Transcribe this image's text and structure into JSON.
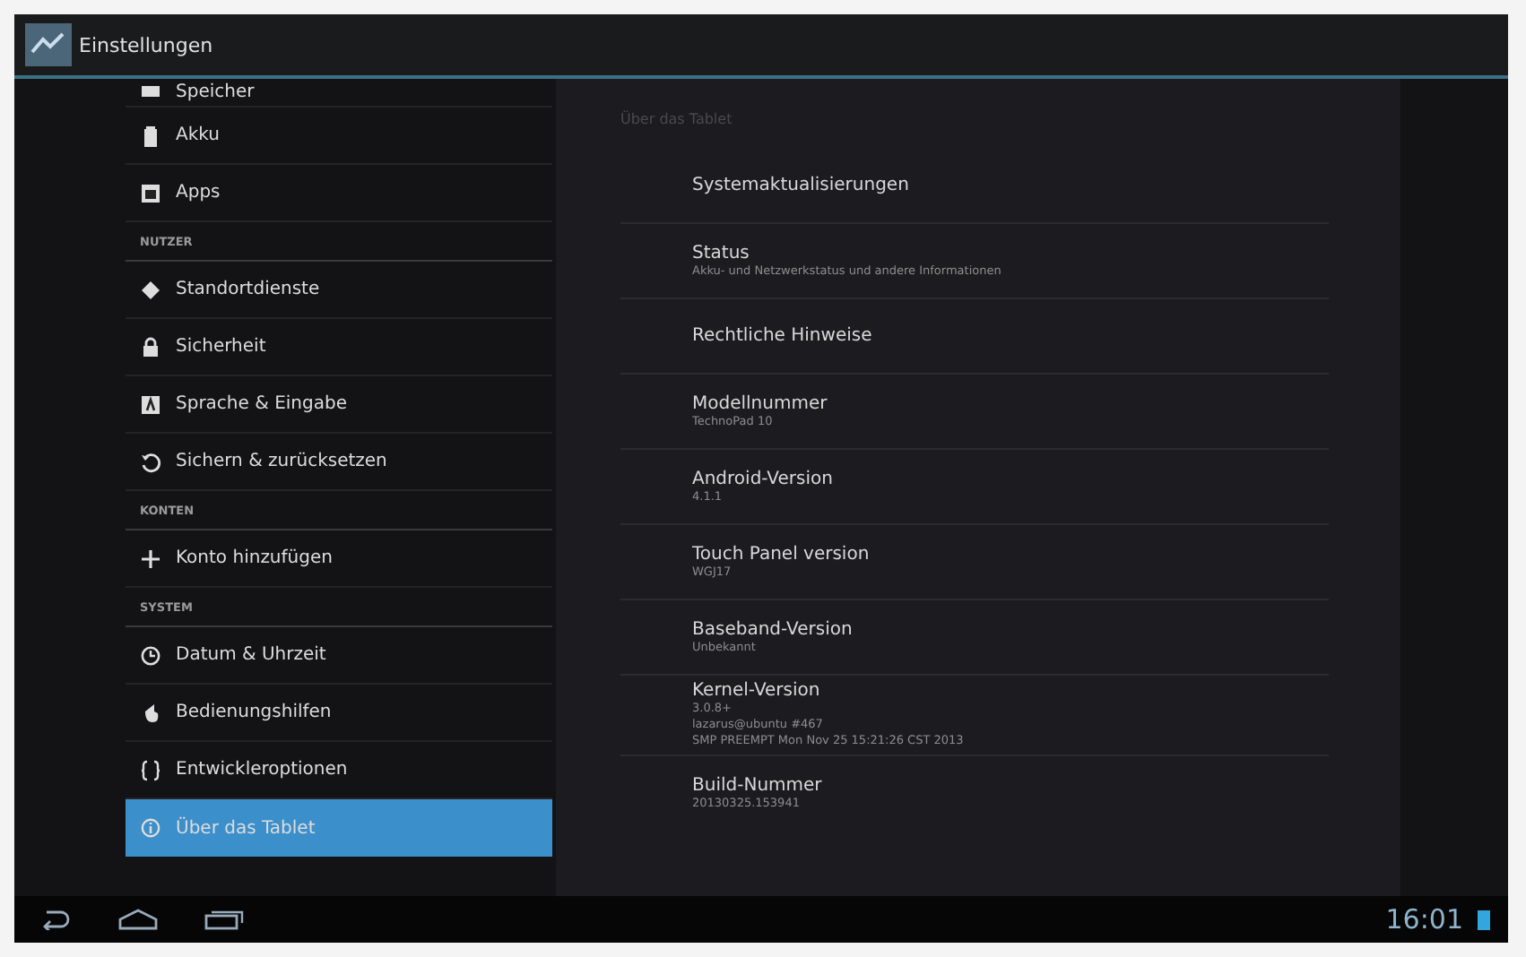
{
  "title_bar": {
    "title": "Einstellungen"
  },
  "sidebar": {
    "items": [
      {
        "kind": "item",
        "label": "Speicher",
        "selected": false
      },
      {
        "kind": "item",
        "label": "Akku",
        "selected": false
      },
      {
        "kind": "item",
        "label": "Apps",
        "selected": false
      },
      {
        "kind": "header",
        "label": "NUTZER"
      },
      {
        "kind": "item",
        "label": "Standortdienste",
        "selected": false
      },
      {
        "kind": "item",
        "label": "Sicherheit",
        "selected": false
      },
      {
        "kind": "item",
        "label": "Sprache & Eingabe",
        "selected": false
      },
      {
        "kind": "item",
        "label": "Sichern & zurücksetzen",
        "selected": false
      },
      {
        "kind": "header",
        "label": "KONTEN"
      },
      {
        "kind": "item",
        "label": "Konto hinzufügen",
        "selected": false
      },
      {
        "kind": "header",
        "label": "SYSTEM"
      },
      {
        "kind": "item",
        "label": "Datum & Uhrzeit",
        "selected": false
      },
      {
        "kind": "item",
        "label": "Bedienungshilfen",
        "selected": false
      },
      {
        "kind": "item",
        "label": "Entwickleroptionen",
        "selected": false
      },
      {
        "kind": "item",
        "label": "Über das Tablet",
        "selected": true
      }
    ]
  },
  "detail": {
    "heading": "Über das Tablet",
    "items": [
      {
        "title": "Systemaktualisierungen"
      },
      {
        "title": "Status",
        "lines": [
          "Akku- und Netzwerkstatus und andere Informationen"
        ]
      },
      {
        "title": "Rechtliche Hinweise"
      },
      {
        "title": "Modellnummer",
        "lines": [
          "TechnoPad 10"
        ]
      },
      {
        "title": "Android-Version",
        "lines": [
          "4.1.1"
        ]
      },
      {
        "title": "Touch Panel version",
        "lines": [
          "WGJ17"
        ]
      },
      {
        "title": "Baseband-Version",
        "lines": [
          "Unbekannt"
        ]
      },
      {
        "title": "Kernel-Version",
        "lines": [
          "3.0.8+",
          "lazarus@ubuntu #467",
          "SMP PREEMPT Mon Nov 25 15:21:26 CST 2013"
        ]
      },
      {
        "title": "Build-Nummer",
        "lines": [
          "20130325.153941"
        ]
      }
    ]
  },
  "nav_bar": {
    "time": "16:01"
  }
}
